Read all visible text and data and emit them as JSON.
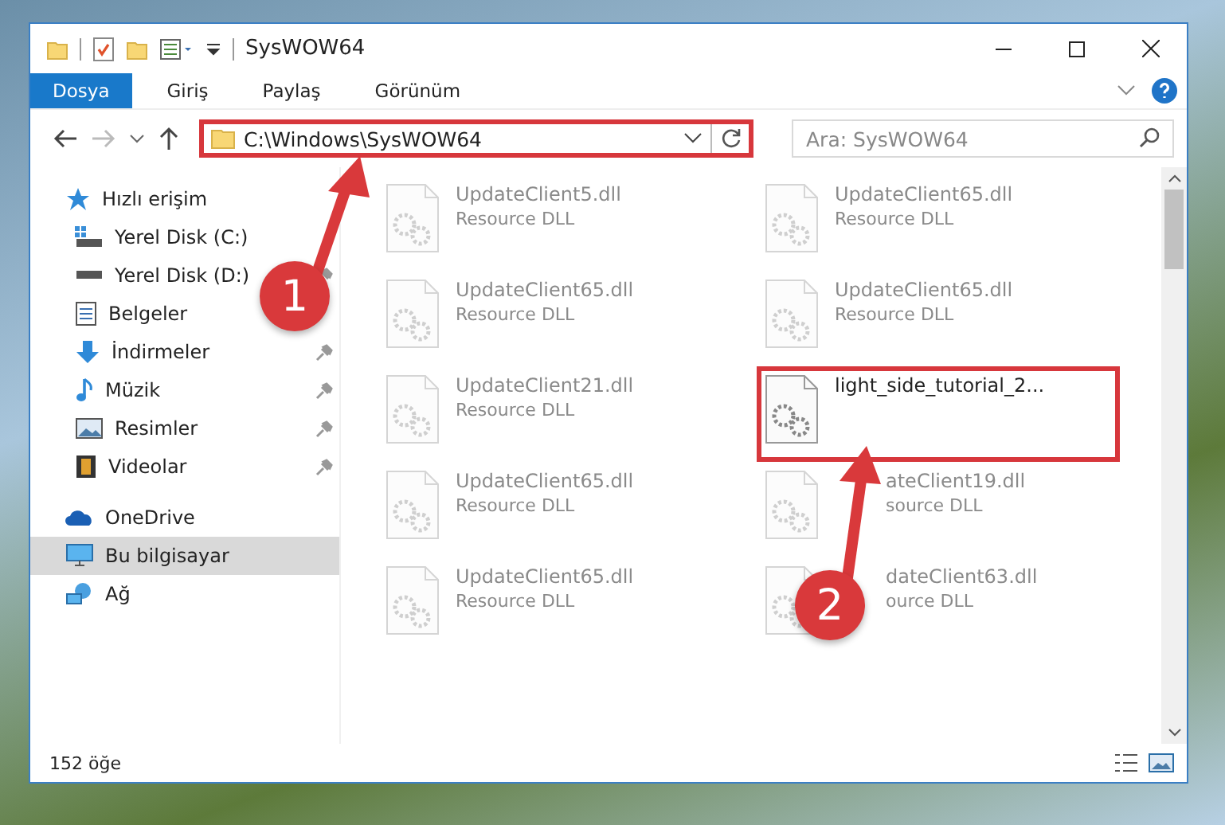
{
  "window": {
    "title": "SysWOW64"
  },
  "ribbon_tabs": [
    {
      "label": "Dosya",
      "selected": true
    },
    {
      "label": "Giriş",
      "selected": false
    },
    {
      "label": "Paylaş",
      "selected": false
    },
    {
      "label": "Görünüm",
      "selected": false
    }
  ],
  "address": {
    "path": "C:\\Windows\\SysWOW64"
  },
  "search": {
    "placeholder": "Ara: SysWOW64"
  },
  "sidebar": {
    "items": [
      {
        "label": "Hızlı erişim",
        "selected": false,
        "children": [
          {
            "label": "Yerel Disk (C:)",
            "pinned": false
          },
          {
            "label": "Yerel Disk (D:)",
            "pinned": true
          },
          {
            "label": "Belgeler",
            "pinned": false
          },
          {
            "label": "İndirmeler",
            "pinned": true
          },
          {
            "label": "Müzik",
            "pinned": true
          },
          {
            "label": "Resimler",
            "pinned": true
          },
          {
            "label": "Videolar",
            "pinned": true
          }
        ]
      },
      {
        "label": "OneDrive",
        "selected": false
      },
      {
        "label": "Bu bilgisayar",
        "selected": true
      },
      {
        "label": "Ağ",
        "selected": false
      }
    ]
  },
  "files": [
    {
      "name": "UpdateClient5.dll",
      "type": "Resource DLL",
      "kind": "blurred"
    },
    {
      "name": "UpdateClient65.dll",
      "type": "Resource DLL",
      "kind": "blurred"
    },
    {
      "name": "UpdateClient65.dll",
      "type": "Resource DLL",
      "kind": "blurred"
    },
    {
      "name": "UpdateClient65.dll",
      "type": "Resource DLL",
      "kind": "blurred"
    },
    {
      "name": "UpdateClient21.dll",
      "type": "Resource DLL",
      "kind": "blurred"
    },
    {
      "name": "light_side_tutorial_2...",
      "kind": "plain"
    },
    {
      "name": "UpdateClient65.dll",
      "type": "Resource DLL",
      "kind": "blurred"
    },
    {
      "name": "ateClient19.dll",
      "type": "source DLL",
      "kind": "partial"
    },
    {
      "name": "UpdateClient65.dll",
      "type": "Resource DLL",
      "kind": "blurred"
    },
    {
      "name": "dateClient63.dll",
      "type": "ource DLL",
      "kind": "partial"
    }
  ],
  "status_bar": {
    "count": "152 öğe"
  },
  "annotations": [
    {
      "number": "1"
    },
    {
      "number": "2"
    }
  ]
}
